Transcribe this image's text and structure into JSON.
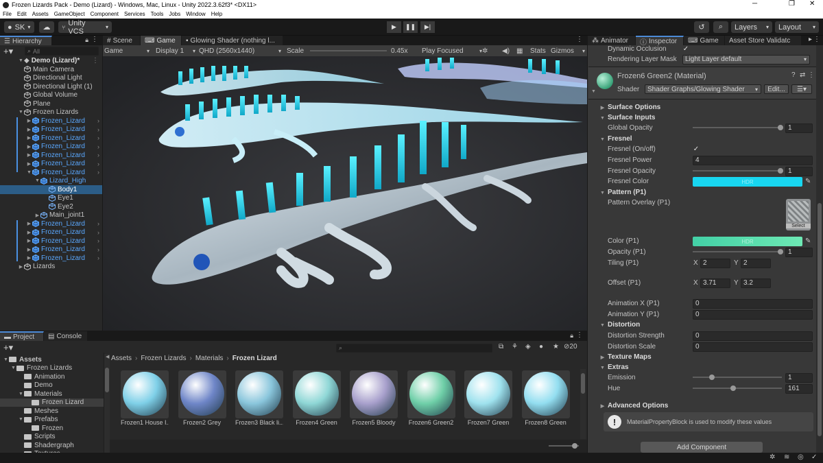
{
  "window": {
    "title": "Frozen Lizards Pack - Demo (Lizard) - Windows, Mac, Linux - Unity 2022.3.62f3* <DX11>",
    "menu": [
      "File",
      "Edit",
      "Assets",
      "GameObject",
      "Component",
      "Services",
      "Tools",
      "Jobs",
      "Window",
      "Help"
    ]
  },
  "toolbar": {
    "account": "SK",
    "vcs": "Unity VCS",
    "layers": "Layers",
    "layout": "Layout"
  },
  "hierarchy": {
    "tab": "Hierarchy",
    "search_placeholder": "All",
    "scene": "Demo (Lizard)*",
    "items": [
      {
        "label": "Main Camera",
        "depth": 1,
        "type": "go"
      },
      {
        "label": "Directional Light",
        "depth": 1,
        "type": "go"
      },
      {
        "label": "Directional Light (1)",
        "depth": 1,
        "type": "go"
      },
      {
        "label": "Global Volume",
        "depth": 1,
        "type": "go"
      },
      {
        "label": "Plane",
        "depth": 1,
        "type": "go"
      },
      {
        "label": "Frozen Lizards",
        "depth": 1,
        "type": "go",
        "expanded": true
      },
      {
        "label": "Frozen_Lizard",
        "depth": 2,
        "type": "prefab"
      },
      {
        "label": "Frozen_Lizard",
        "depth": 2,
        "type": "prefab"
      },
      {
        "label": "Frozen_Lizard",
        "depth": 2,
        "type": "prefab"
      },
      {
        "label": "Frozen_Lizard",
        "depth": 2,
        "type": "prefab"
      },
      {
        "label": "Frozen_Lizard",
        "depth": 2,
        "type": "prefab"
      },
      {
        "label": "Frozen_Lizard",
        "depth": 2,
        "type": "prefab"
      },
      {
        "label": "Frozen_Lizard",
        "depth": 2,
        "type": "prefab",
        "expanded": true
      },
      {
        "label": "Lizard_High",
        "depth": 3,
        "type": "prefab",
        "expanded": true
      },
      {
        "label": "Body1",
        "depth": 4,
        "type": "child",
        "selected": true
      },
      {
        "label": "Eye1",
        "depth": 4,
        "type": "child"
      },
      {
        "label": "Eye2",
        "depth": 4,
        "type": "child"
      },
      {
        "label": "Main_joint1",
        "depth": 3,
        "type": "child"
      },
      {
        "label": "Frozen_Lizard",
        "depth": 2,
        "type": "prefab"
      },
      {
        "label": "Frozen_Lizard",
        "depth": 2,
        "type": "prefab"
      },
      {
        "label": "Frozen_Lizard",
        "depth": 2,
        "type": "prefab"
      },
      {
        "label": "Frozen_Lizard",
        "depth": 2,
        "type": "prefab"
      },
      {
        "label": "Frozen_Lizard",
        "depth": 2,
        "type": "prefab"
      },
      {
        "label": "Lizards",
        "depth": 1,
        "type": "go"
      }
    ]
  },
  "center_tabs": [
    "Scene",
    "Game",
    "Glowing Shader (nothing l..."
  ],
  "game_toolbar": {
    "mode": "Game",
    "display": "Display 1",
    "resolution": "QHD (2560x1440)",
    "scale_label": "Scale",
    "scale_value": "0.45x",
    "play_focused": "Play Focused",
    "stats": "Stats",
    "gizmos": "Gizmos"
  },
  "right_tabs": [
    "Animator",
    "Inspector",
    "Game",
    "Asset Store Validatc"
  ],
  "inspector": {
    "dynamic_occlusion": "Dynamic Occlusion",
    "rendering_layer_mask": "Rendering Layer Mask",
    "rendering_layer_value": "Light Layer default",
    "material_name": "Frozen6 Green2 (Material)",
    "shader_label": "Shader",
    "shader_value": "Shader Graphs/Glowing Shader",
    "edit_button": "Edit...",
    "surface_options": "Surface Options",
    "surface_inputs": "Surface Inputs",
    "global_opacity": "Global Opacity",
    "global_opacity_value": "1",
    "fresnel": "Fresnel",
    "fresnel_onoff": "Fresnel (On/off)",
    "fresnel_power": "Fresnel Power",
    "fresnel_power_value": "4",
    "fresnel_opacity": "Fresnel Opacity",
    "fresnel_opacity_value": "1",
    "fresnel_color": "Fresnel Color",
    "hdr": "HDR",
    "pattern": "Pattern (P1)",
    "pattern_overlay": "Pattern Overlay (P1)",
    "select": "Select",
    "color_p1": "Color (P1)",
    "opacity_p1": "Opacity (P1)",
    "opacity_p1_value": "1",
    "tiling_p1": "Tiling (P1)",
    "tiling_x": "2",
    "tiling_y": "2",
    "offset_p1": "Offset (P1)",
    "offset_x": "3.71",
    "offset_y": "3.2",
    "anim_x": "Animation X (P1)",
    "anim_x_value": "0",
    "anim_y": "Animation Y (P1)",
    "anim_y_value": "0",
    "distortion": "Distortion",
    "distortion_strength": "Distortion Strength",
    "distortion_strength_value": "0",
    "distortion_scale": "Distortion Scale",
    "distortion_scale_value": "0",
    "texture_maps": "Texture Maps",
    "extras": "Extras",
    "emission": "Emission",
    "emission_value": "1",
    "hue": "Hue",
    "hue_value": "161",
    "advanced_options": "Advanced Options",
    "info_message": "MaterialPropertyBlock is used to modify these values",
    "add_component": "Add Component",
    "x": "X",
    "y": "Y",
    "colors": {
      "fresnel": "#18d6f0",
      "p1_left": "#43d0a6",
      "p1_right": "#6ee9b4"
    }
  },
  "project": {
    "tabs": [
      "Project",
      "Console"
    ],
    "search_count": "20",
    "tree": [
      {
        "label": "Assets",
        "depth": 0,
        "bold": true
      },
      {
        "label": "Frozen Lizards",
        "depth": 1
      },
      {
        "label": "Animation",
        "depth": 2
      },
      {
        "label": "Demo",
        "depth": 2
      },
      {
        "label": "Materials",
        "depth": 2
      },
      {
        "label": "Frozen Lizard",
        "depth": 3,
        "selected": true
      },
      {
        "label": "Meshes",
        "depth": 2
      },
      {
        "label": "Prefabs",
        "depth": 2
      },
      {
        "label": "Frozen",
        "depth": 3
      },
      {
        "label": "Scripts",
        "depth": 2
      },
      {
        "label": "Shadergraph",
        "depth": 2
      },
      {
        "label": "Textures",
        "depth": 2
      }
    ],
    "breadcrumb": [
      "Assets",
      "Frozen Lizards",
      "Materials",
      "Frozen Lizard"
    ],
    "assets": [
      {
        "label": "Frozen1 House I...",
        "color": "#7fd0e8"
      },
      {
        "label": "Frozen2 Grey",
        "color": "#6f86c8"
      },
      {
        "label": "Frozen3 Black li...",
        "color": "#8ac6dc"
      },
      {
        "label": "Frozen4 Green",
        "color": "#8fd7d6"
      },
      {
        "label": "Frozen5 Bloody",
        "color": "#a8a0cc"
      },
      {
        "label": "Frozen6 Green2",
        "color": "#6fcfa8"
      },
      {
        "label": "Frozen7 Green",
        "color": "#9fe2ee"
      },
      {
        "label": "Frozen8 Green",
        "color": "#93def0"
      }
    ]
  }
}
